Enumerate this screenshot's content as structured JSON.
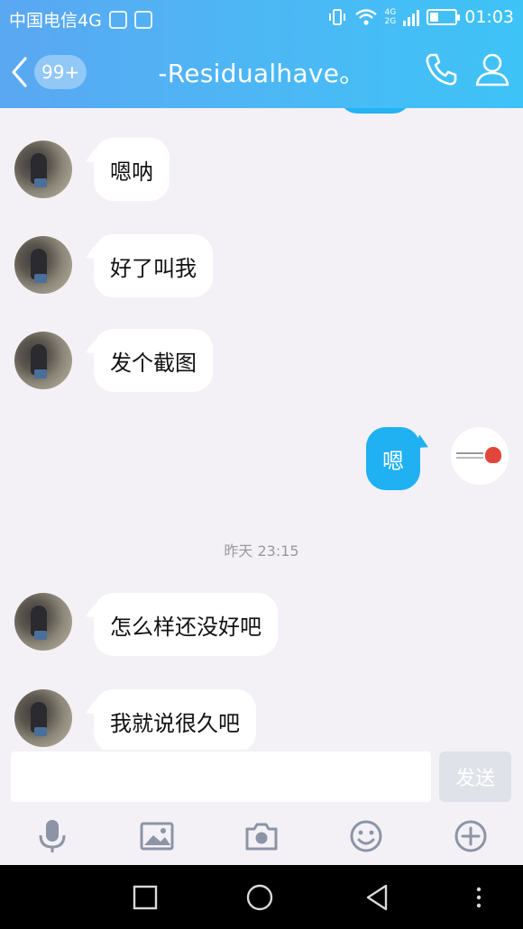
{
  "status_bar": {
    "carrier": "中国电信4G",
    "net_label_top": "4G",
    "net_label_bottom": "2G",
    "time": "01:03",
    "battery_level": 0.28
  },
  "header": {
    "unread_badge": "99+",
    "title": "-Residualhave。",
    "accent": "#3ec3f7"
  },
  "messages": [
    {
      "side": "left",
      "text": "嗯呐"
    },
    {
      "side": "left",
      "text": "好了叫我"
    },
    {
      "side": "left",
      "text": "发个截图"
    },
    {
      "side": "right",
      "text": "嗯"
    },
    {
      "type": "time",
      "text": "昨天 23:15"
    },
    {
      "side": "left",
      "text": "怎么样还没好吧"
    },
    {
      "side": "left",
      "text": "我就说很久吧"
    }
  ],
  "composer": {
    "input_value": "",
    "send_label": "发送"
  },
  "toolbar": {
    "icons": [
      "microphone-icon",
      "image-icon",
      "camera-icon",
      "emoji-icon",
      "plus-icon"
    ]
  },
  "system_nav": {
    "icons": [
      "recent-apps-icon",
      "home-icon",
      "back-icon",
      "more-icon"
    ]
  }
}
